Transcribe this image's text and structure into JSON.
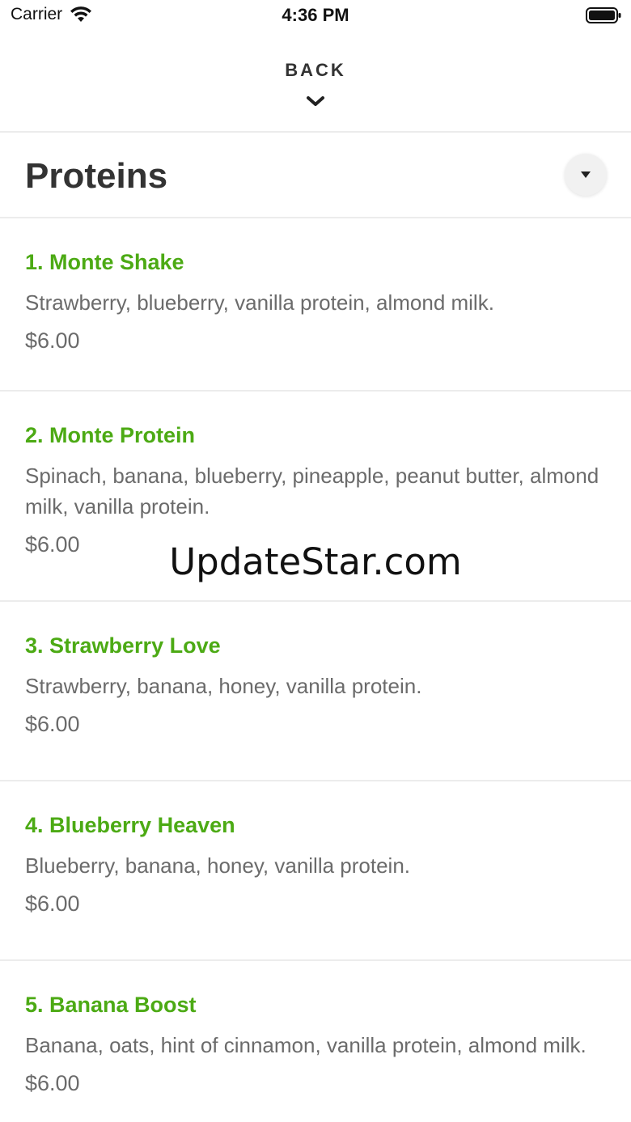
{
  "status_bar": {
    "carrier": "Carrier",
    "time": "4:36 PM",
    "wifi_icon": "wifi-icon",
    "battery_icon": "battery-full-icon"
  },
  "nav": {
    "back_label": "BACK",
    "back_icon": "chevron-down-icon"
  },
  "category": {
    "title": "Proteins",
    "dropdown_icon": "caret-down-icon"
  },
  "menu": {
    "items": [
      {
        "name": "1. Monte Shake",
        "description": "Strawberry, blueberry, vanilla protein, almond milk.",
        "price": "$6.00"
      },
      {
        "name": "2. Monte Protein",
        "description": "Spinach, banana, blueberry, pineapple, peanut butter, almond milk, vanilla protein.",
        "price": "$6.00"
      },
      {
        "name": "3. Strawberry Love",
        "description": "Strawberry, banana, honey, vanilla protein.",
        "price": "$6.00"
      },
      {
        "name": "4. Blueberry Heaven",
        "description": "Blueberry, banana, honey, vanilla protein.",
        "price": "$6.00"
      },
      {
        "name": "5. Banana Boost",
        "description": "Banana, oats, hint of cinnamon, vanilla protein, almond milk.",
        "price": "$6.00"
      }
    ]
  },
  "watermark": "UpdateStar.com",
  "colors": {
    "accent_green": "#4caa14",
    "text_dark": "#333333",
    "text_gray": "#6b6b6b",
    "divider": "#ececec"
  }
}
